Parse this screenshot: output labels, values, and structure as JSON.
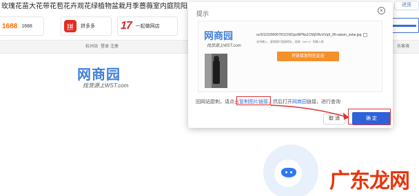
{
  "page": {
    "title": "玫瑰花苗大花带花苞花卉观花绿植物盆栽月季蔷薇室内庭院阳台",
    "top_right_chip": "进货"
  },
  "shops": [
    {
      "logo": "1688",
      "label": "1688"
    },
    {
      "logo": "拼",
      "label": "拼多多"
    },
    {
      "logo": "17",
      "label": "一起做网店"
    }
  ],
  "menu": {
    "items": [
      "杭州站",
      "登录",
      "注册"
    ],
    "right_item": "乐客境"
  },
  "bg_logo": {
    "wordmark": "网商园",
    "subtitle": "找货源上WST.com"
  },
  "watermark": {
    "text": "广东龙网"
  },
  "dialog": {
    "title": "提示",
    "close_glyph": "×",
    "logo": {
      "wordmark": "网商园",
      "subtitle": "找货源上WST.com"
    },
    "url_text": "ru/3/11520006?/01CN01psNPRa1CMjORvUVq9_90-saturn_solar.jpg",
    "tip_text": "支持输入，复制图片链接地址，粘贴（ctrl+v）到输入框",
    "paste_button": "将链接复制在此处",
    "instruction": {
      "before": "回网站厨刺，请点击",
      "link1": "复制图片链接",
      "middle": "，然后打开",
      "link2": "网商园",
      "after": "链接，进行查询"
    },
    "cancel_label": "取 消",
    "ok_label": "确 定"
  },
  "colors": {
    "accent": "#2f62d8",
    "highlight": "#e03030",
    "paste": "#f5902a",
    "brand_blue": "#3f7fdc"
  }
}
